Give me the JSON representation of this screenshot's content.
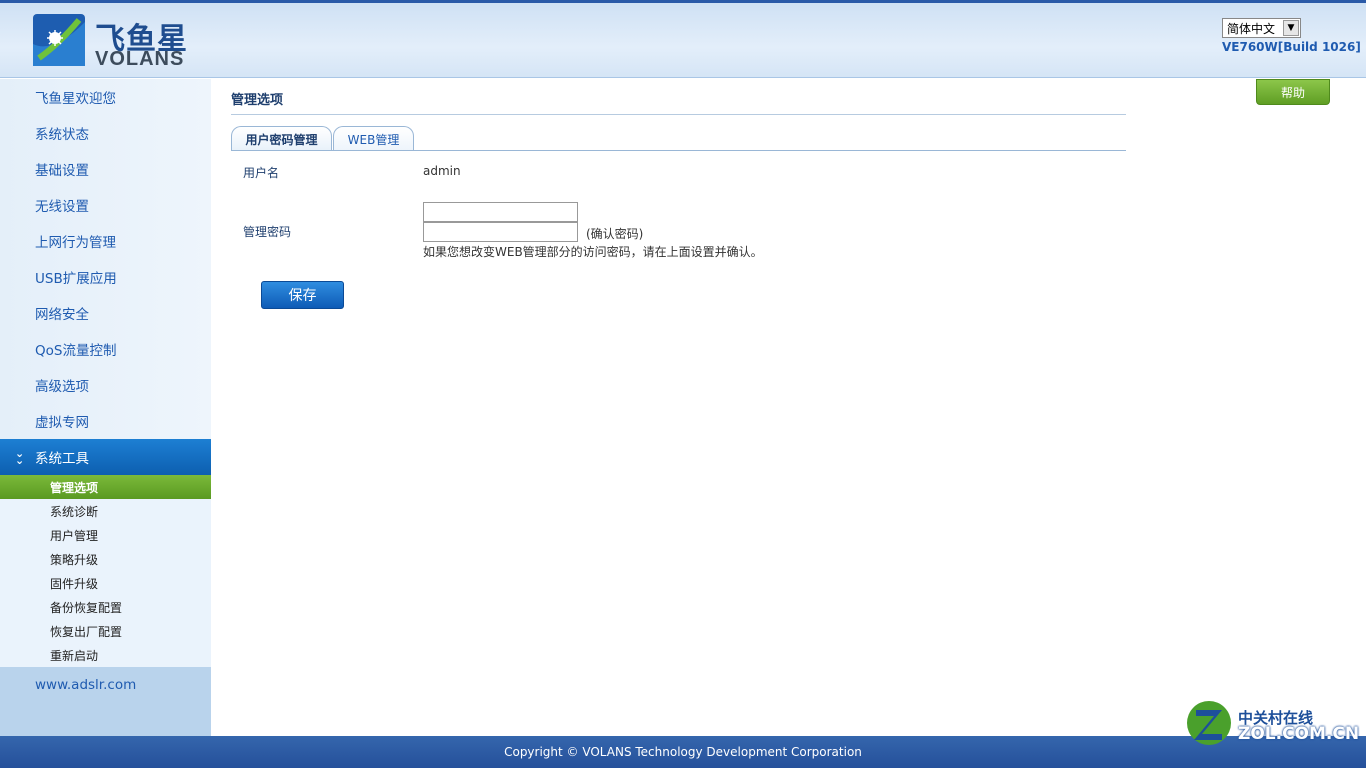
{
  "header": {
    "logo_cn": "飞鱼星",
    "logo_en": "VOLANS",
    "language": "简体中文",
    "version": "VE760W[Build 1026]"
  },
  "sidebar": {
    "items": [
      {
        "label": "飞鱼星欢迎您"
      },
      {
        "label": "系统状态"
      },
      {
        "label": "基础设置"
      },
      {
        "label": "无线设置"
      },
      {
        "label": "上网行为管理"
      },
      {
        "label": "USB扩展应用"
      },
      {
        "label": "网络安全"
      },
      {
        "label": "QoS流量控制"
      },
      {
        "label": "高级选项"
      },
      {
        "label": "虚拟专网"
      }
    ],
    "active_section": "系统工具",
    "sub_items": [
      {
        "label": "管理选项",
        "active": true
      },
      {
        "label": "系统诊断"
      },
      {
        "label": "用户管理"
      },
      {
        "label": "策略升级"
      },
      {
        "label": "固件升级"
      },
      {
        "label": "备份恢复配置"
      },
      {
        "label": "恢复出厂配置"
      },
      {
        "label": "重新启动"
      }
    ],
    "link": "www.adslr.com"
  },
  "main": {
    "title": "管理选项",
    "help_label": "帮助",
    "tabs": [
      {
        "label": "用户密码管理",
        "active": true
      },
      {
        "label": "WEB管理"
      }
    ],
    "form": {
      "username_label": "用户名",
      "username_value": "admin",
      "password_label": "管理密码",
      "password_value": "",
      "confirm_value": "",
      "confirm_hint": "(确认密码)",
      "note": "如果您想改变WEB管理部分的访问密码，请在上面设置并确认。",
      "save_label": "保存"
    }
  },
  "footer": {
    "copyright": "Copyright © VOLANS Technology Development Corporation"
  },
  "watermark": {
    "cn": "中关村在线",
    "en": "ZOL.COM.CN"
  },
  "colors": {
    "brand_blue": "#1f5bb0",
    "nav_active": "#0d5fb0",
    "sub_active": "#5a9a22",
    "footer_bg": "#2a5aa8"
  }
}
